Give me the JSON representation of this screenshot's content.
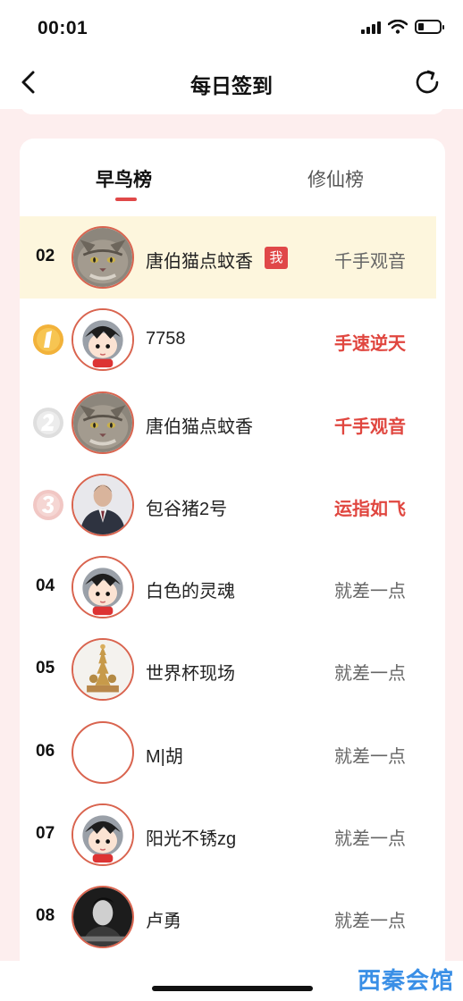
{
  "status_bar": {
    "time": "00:01"
  },
  "nav": {
    "title": "每日签到"
  },
  "tabs": [
    {
      "label": "早鸟榜",
      "active": true
    },
    {
      "label": "修仙榜",
      "active": false
    }
  ],
  "colors": {
    "accent": "#e04848",
    "highlight_row": "#fdf6dd",
    "page_bg": "#fdeeee",
    "watermark": "#3a8fe6"
  },
  "ranking": [
    {
      "rank": "02",
      "name": "唐伯猫点蚊香",
      "me_badge": "我",
      "title": "千手观音",
      "avatar": "cat-avatar",
      "is_me": true
    },
    {
      "rank": "1",
      "name": "7758",
      "title": "手速逆天",
      "avatar": "cartoon-avatar",
      "medal": "gold"
    },
    {
      "rank": "2",
      "name": "唐伯猫点蚊香",
      "title": "千手观音",
      "avatar": "cat-avatar",
      "medal": "silver"
    },
    {
      "rank": "3",
      "name": "包谷猪2号",
      "title": "运指如飞",
      "avatar": "suit-man-avatar",
      "medal": "bronze"
    },
    {
      "rank": "04",
      "name": "白色的灵魂",
      "title": "就差一点",
      "avatar": "cartoon-avatar"
    },
    {
      "rank": "05",
      "name": "世界杯现场",
      "title": "就差一点",
      "avatar": "golden-statue-avatar"
    },
    {
      "rank": "06",
      "name": "M|胡",
      "title": "就差一点",
      "avatar": "blank-avatar"
    },
    {
      "rank": "07",
      "name": "阳光不锈zg",
      "title": "就差一点",
      "avatar": "cartoon-avatar"
    },
    {
      "rank": "08",
      "name": "卢勇",
      "title": "就差一点",
      "avatar": "dark-portrait-avatar"
    }
  ],
  "watermark": "西秦会馆"
}
